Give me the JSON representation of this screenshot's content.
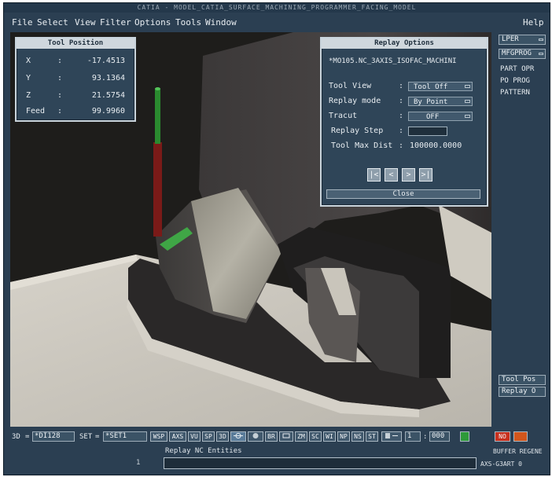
{
  "window": {
    "title": "CATIA - MODEL_CATIA_SURFACE_MACHINING_PROGRAMMER_FACING_MODEL"
  },
  "menu": {
    "file": "File",
    "select": "Select",
    "view": "View",
    "filter": "Filter",
    "options": "Options",
    "tools": "Tools",
    "window": "Window",
    "help": "Help"
  },
  "tool_position": {
    "title": "Tool Position",
    "rows": [
      {
        "label": "X",
        "value": "-17.4513"
      },
      {
        "label": "Y",
        "value": "93.1364"
      },
      {
        "label": "Z",
        "value": "21.5754"
      },
      {
        "label": "Feed",
        "value": "99.9960"
      }
    ]
  },
  "replay_options": {
    "title": "Replay Options",
    "program": "*MO105.NC_3AXIS_ISOFAC_MACHINI",
    "tool_view_label": "Tool View",
    "tool_view_value": "Tool Off",
    "replay_mode_label": "Replay mode",
    "replay_mode_value": "By Point",
    "tracut_label": "Tracut",
    "tracut_value": "OFF",
    "replay_step_label": "Replay Step",
    "tool_max_dist_label": "Tool Max Dist",
    "tool_max_dist_value": "100000.0000",
    "nav": {
      "first": "|<",
      "prev": "<",
      "next": ">",
      "last": ">|"
    },
    "close": "Close"
  },
  "right_panel": {
    "lper": "LPER",
    "mfgprog": "MFGPROG",
    "part_opr": "PART OPR",
    "po_prog": "PO PROG",
    "pattern": "PATTERN",
    "tool_pos": "Tool Pos",
    "replay": "Replay O"
  },
  "statusbar": {
    "mode_label": "3D",
    "doc_value": "*DI128",
    "set_label": "SET",
    "set_value": "*SET1",
    "buttons": [
      "WSP",
      "AXS",
      "VU",
      "SP",
      "3D",
      "",
      "",
      "BR",
      "",
      "ZM",
      "SC",
      "WI",
      "NP",
      "NS",
      "ST"
    ],
    "page_value": "1",
    "zoom_value": "000",
    "no_label": "NO",
    "colors": {
      "green": "#2e9a3a",
      "red": "#c8301e",
      "orange": "#d2561c"
    }
  },
  "prompt": {
    "message": "Replay NC Entities",
    "marker": "1",
    "buffer": "BUFFER REGENE",
    "axis_status": "AXS-G3ART 0"
  },
  "colors": {
    "panel_bg": "#2f4558",
    "app_bg": "#2b3f52",
    "tool_green": "#46c04a",
    "tool_red": "#8c1e1c"
  }
}
